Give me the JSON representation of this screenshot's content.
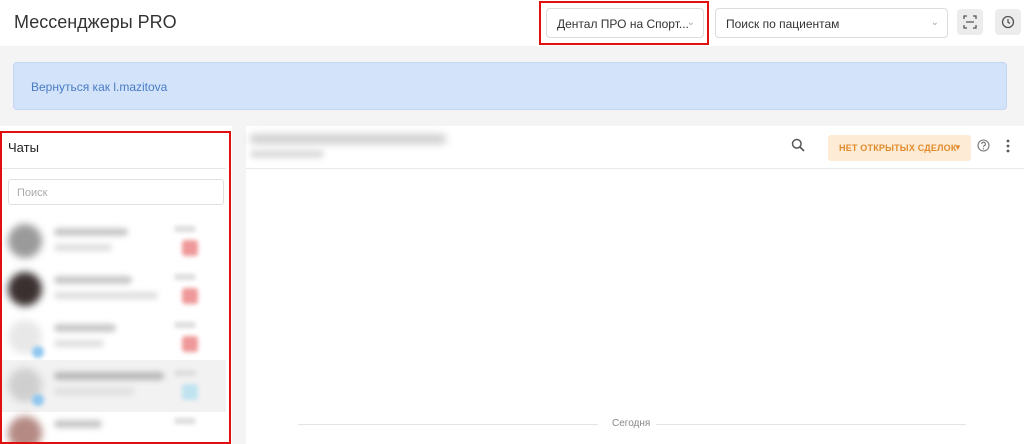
{
  "header": {
    "title": "Мессенджеры PRO",
    "clinic_select": "Дентал ПРО на Спорт...",
    "patient_search": "Поиск по пациентам",
    "scan_icon": "scan-icon",
    "history_icon": "clock-icon"
  },
  "banner": {
    "link": "Вернуться как l.mazitova"
  },
  "chats": {
    "title": "Чаты",
    "search_placeholder": "Поиск"
  },
  "conversation": {
    "deals_button": "НЕТ ОТКРЫТЫХ СДЕЛОК",
    "day_separator": "Сегодня"
  },
  "colors": {
    "highlight": "#e01010",
    "banner_bg": "#d2e3fa",
    "link": "#4a7cc4",
    "deals_bg": "#fdebd6",
    "deals_text": "#e08a2a"
  }
}
